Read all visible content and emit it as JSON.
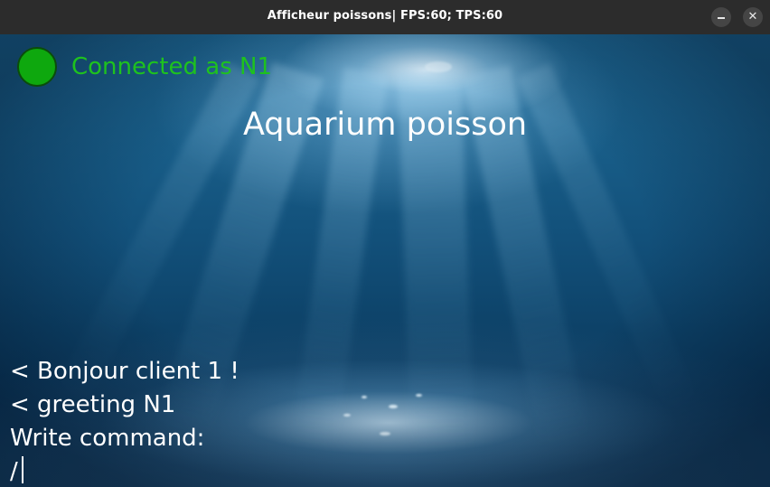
{
  "window": {
    "title": "Afficheur poissons| FPS:60; TPS:60",
    "minimize_glyph": "",
    "close_glyph": "✕"
  },
  "status": {
    "text": "Connected as N1",
    "color": "#1ec21e",
    "indicator_color": "#0ea80e",
    "icon": "connection-status-dot"
  },
  "scene": {
    "heading": "Aquarium poisson"
  },
  "console": {
    "lines": [
      "< Bonjour client 1 !",
      "< greeting N1",
      "Write command:"
    ],
    "input_value": "/"
  }
}
